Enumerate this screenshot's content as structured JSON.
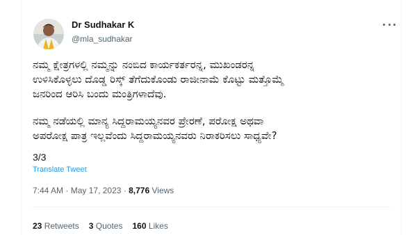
{
  "author": {
    "name": "Dr Sudhakar K",
    "handle": "@mla_sudhakar"
  },
  "tweet": {
    "paragraph1": [
      "ನಮ್ಮ ಕ್ಷೇತ್ರಗಳಲ್ಲಿ ನಮ್ಮನ್ನು ನಂಬಿದ ಕಾರ್ಯಕರ್ತರನ್ನ, ಮುಖಂಡರನ್ನ",
      "ಉಳಿಸಿಕೊಳ್ಳಲು ದೊಡ್ಡ ರಿಸ್ಕ್ ತೆಗೆದುಕೊಂಡು ರಾಜೀನಾಮೆ ಕೊಟ್ಟು ಮತ್ತೊಮ್ಮೆ",
      "ಜನರಿಂದ ಆರಿಸಿ ಬಂದು ಮಂತ್ರಿಗಳಾದೆವು."
    ],
    "paragraph2": [
      "ನಮ್ಮ ನಡೆಯಲ್ಲಿ ಮಾನ್ಯ ಸಿದ್ದರಾಮಯ್ಯನವರ ಪ್ರೇರಣೆ, ಪರೋಕ್ಷ ಅಥವಾ",
      "ಅಪರೋಕ್ಷ ಪಾತ್ರ ಇಲ್ಲವೆಂದು ಸಿದ್ದರಾಮಯ್ಯನವರು ನಿರಾಕರಿಸಲು ಸಾಧ್ಯವೇ?"
    ],
    "thread_counter": "3/3",
    "translate_label": "Translate Tweet"
  },
  "meta": {
    "time": "7:44 AM",
    "separator": "·",
    "date": "May 17, 2023",
    "views_count": "8,776",
    "views_label": "Views"
  },
  "stats": {
    "retweets_count": "23",
    "retweets_label": "Retweets",
    "quotes_count": "3",
    "quotes_label": "Quotes",
    "likes_count": "160",
    "likes_label": "Likes"
  },
  "colors": {
    "link": "#1d9bf0",
    "secondary_text": "#536471",
    "primary_text": "#0f1419"
  },
  "icons": {
    "more": "more-options-icon"
  }
}
